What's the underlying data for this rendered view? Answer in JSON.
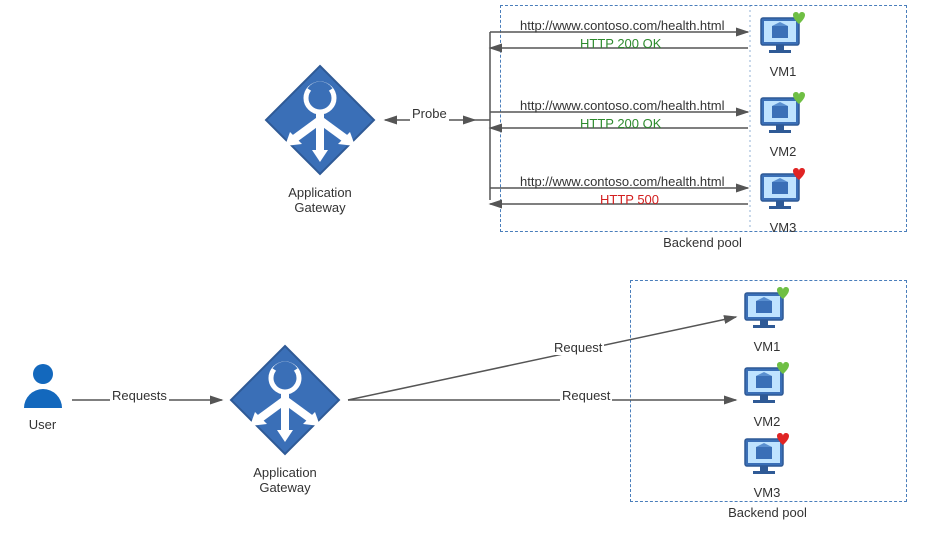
{
  "colors": {
    "azure": "#3a6fb7",
    "azureDark": "#2f5a96",
    "green": "#6fbf44",
    "red": "#e02424",
    "stroke": "#555"
  },
  "gateway_label": "Application\nGateway",
  "backend_pool_label": "Backend pool",
  "user_label": "User",
  "top": {
    "probe_label": "Probe",
    "vms": [
      {
        "name": "VM1",
        "url": "http://www.contoso.com/health.html",
        "status": "HTTP 200 OK",
        "ok": true
      },
      {
        "name": "VM2",
        "url": "http://www.contoso.com/health.html",
        "status": "HTTP 200 OK",
        "ok": true
      },
      {
        "name": "VM3",
        "url": "http://www.contoso.com/health.html",
        "status": "HTTP 500",
        "ok": false
      }
    ]
  },
  "bottom": {
    "requests_label": "Requests",
    "request_label": "Request",
    "vms": [
      {
        "name": "VM1",
        "ok": true,
        "routed": true
      },
      {
        "name": "VM2",
        "ok": true,
        "routed": true
      },
      {
        "name": "VM3",
        "ok": false,
        "routed": false
      }
    ]
  }
}
